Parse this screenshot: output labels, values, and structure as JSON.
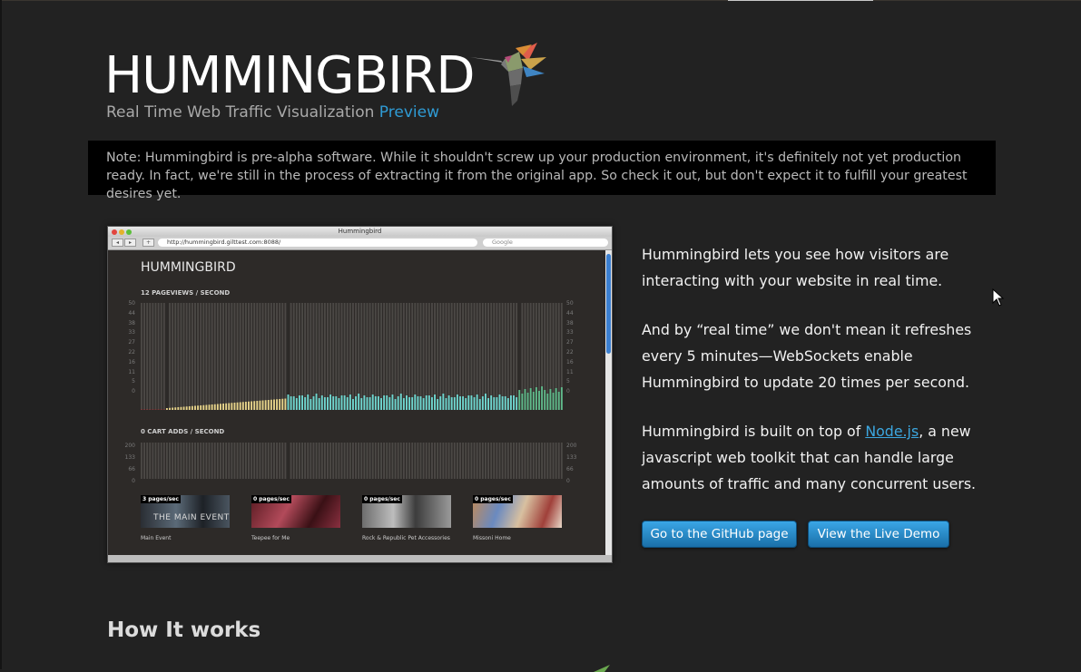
{
  "header": {
    "logo_text": "HUMMINGBIRD",
    "tagline": "Real Time Web Traffic Visualization",
    "tagline_badge": "Preview"
  },
  "note": {
    "text": "Note: Hummingbird is pre-alpha software. While it shouldn't screw up your production environment, it's definitely not yet production ready. In fact, we're still in the process of extracting it from the original app. So check it out, but don't expect it to fulfill your greatest desires yet."
  },
  "screenshot": {
    "window_title": "Hummingbird",
    "url": "http://hummingbird.gilttest.com:8088/",
    "search_placeholder": "Google",
    "app_title": "HUMMINGBIRD",
    "pageviews_label": "12 PAGEVIEWS / SECOND",
    "pageviews_axis": [
      "50",
      "44",
      "38",
      "33",
      "27",
      "22",
      "16",
      "11",
      "5",
      "0"
    ],
    "cart_label": "0 CART ADDS / SECOND",
    "cart_axis": [
      "200",
      "133",
      "66",
      "0"
    ],
    "products": [
      {
        "badge": "3 pages/sec",
        "name": "Main Event",
        "overlay": "THE MAIN EVENT"
      },
      {
        "badge": "0 pages/sec",
        "name": "Teepee for Me",
        "overlay": ""
      },
      {
        "badge": "0 pages/sec",
        "name": "Rock & Republic Pet Accessories",
        "overlay": ""
      },
      {
        "badge": "0 pages/sec",
        "name": "Missoni Home",
        "overlay": ""
      }
    ]
  },
  "description": {
    "p1": "Hummingbird lets you see how visitors are interacting with your website in real time.",
    "p2": "And by “real time” we don't mean it refreshes every 5 minutes—WebSockets enable Hummingbird to update 20 times per second.",
    "p3_before": "Hummingbird is built on top of ",
    "p3_link": "Node.js",
    "p3_after": ", a new javascript web toolkit that can handle large amounts of traffic and many concurrent users."
  },
  "buttons": {
    "github": "Go to the GitHub page",
    "demo": "View the Live Demo"
  },
  "section": {
    "how_title": "How It works"
  },
  "colors": {
    "accent": "#2f9bd4",
    "bar_yellow": "#e6d38a",
    "bar_teal": "#6fd6cf",
    "bar_green": "#5fb98a"
  }
}
